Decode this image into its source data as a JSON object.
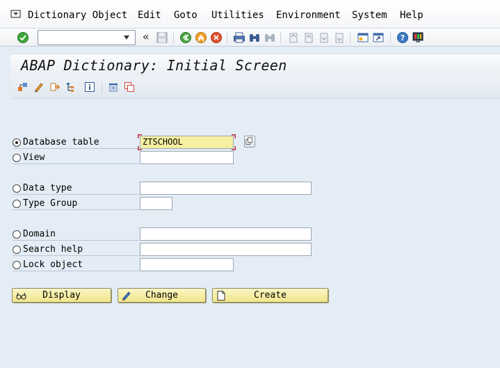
{
  "menubar": {
    "items": [
      {
        "label": "Dictionary Object"
      },
      {
        "label": "Edit"
      },
      {
        "label": "Goto"
      },
      {
        "label": "Utilities"
      },
      {
        "label": "Environment"
      },
      {
        "label": "System"
      },
      {
        "label": "Help"
      }
    ]
  },
  "toolbar": {
    "command_value": "",
    "icons": [
      "enter-icon",
      "save-icon",
      "back-icon",
      "exit-icon",
      "cancel-icon",
      "print-icon",
      "find-icon",
      "find-next-icon",
      "first-page-icon",
      "previous-page-icon",
      "next-page-icon",
      "last-page-icon",
      "create-session-icon",
      "shortcut-icon",
      "help-icon",
      "layout-icon"
    ],
    "chevron": "«"
  },
  "title": "ABAP Dictionary: Initial Screen",
  "app_toolbar": {
    "icons": [
      "other-object-icon",
      "edit-icon",
      "where-used-icon",
      "hierarchy-icon",
      "info-icon",
      "delete-icon",
      "copy-icon"
    ]
  },
  "form": {
    "rows": [
      {
        "label": "Database table",
        "value": "ZTSCHOOL",
        "selected": true
      },
      {
        "label": "View",
        "value": "",
        "selected": false
      },
      {
        "label": "Data type",
        "value": "",
        "selected": false
      },
      {
        "label": "Type Group",
        "value": "",
        "selected": false
      },
      {
        "label": "Domain",
        "value": "",
        "selected": false
      },
      {
        "label": "Search help",
        "value": "",
        "selected": false
      },
      {
        "label": "Lock object",
        "value": "",
        "selected": false
      }
    ]
  },
  "buttons": {
    "display": "Display",
    "change": "Change",
    "create": "Create"
  },
  "colors": {
    "background": "#e4edf5",
    "button_yellow": "#f1e68a",
    "active_field": "#f5efa0",
    "required_marker": "#c0283c"
  }
}
